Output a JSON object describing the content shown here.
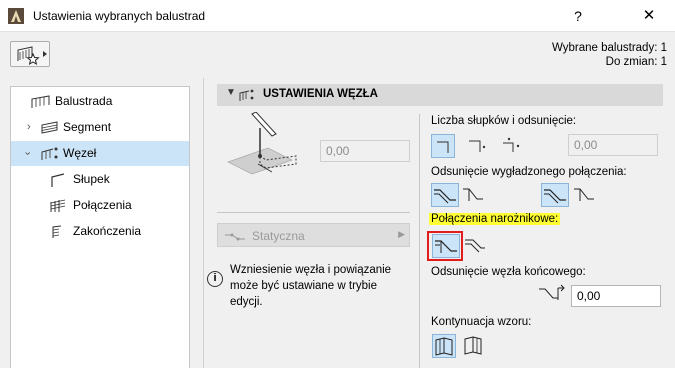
{
  "window": {
    "title": "Ustawienia wybranych balustrad",
    "help_label": "?",
    "close_label": "✕"
  },
  "status": {
    "selected": "Wybrane balustrady: 1",
    "to_change": "Do zmian: 1"
  },
  "tree": {
    "items": [
      {
        "label": "Balustrada",
        "icon": "railing-icon"
      },
      {
        "label": "Segment",
        "icon": "segment-icon"
      },
      {
        "label": "Węzeł",
        "icon": "node-icon"
      },
      {
        "label": "Słupek",
        "icon": "post-icon"
      },
      {
        "label": "Połączenia",
        "icon": "connections-icon"
      },
      {
        "label": "Zakończenia",
        "icon": "endings-icon"
      }
    ]
  },
  "section": {
    "title": "USTAWIENIA WĘZŁA"
  },
  "left": {
    "node_offset_value": "0,00",
    "type_dropdown": "Statyczna",
    "info_text": "Wzniesienie węzła i powiązanie może być ustawiane w trybie edycji."
  },
  "right": {
    "posts_label": "Liczba słupków i odsunięcie:",
    "posts_value": "0,00",
    "smooth_label": "Odsunięcie wygładzonego połączenia:",
    "corner_label": "Połączenia narożnikowe:",
    "end_offset_label": "Odsunięcie węzła końcowego:",
    "end_offset_value": "0,00",
    "pattern_label": "Kontynuacja wzoru:"
  },
  "colors": {
    "highlight": "#ffff33",
    "selection": "#cce4f7",
    "red_box": "#e01c1c"
  }
}
